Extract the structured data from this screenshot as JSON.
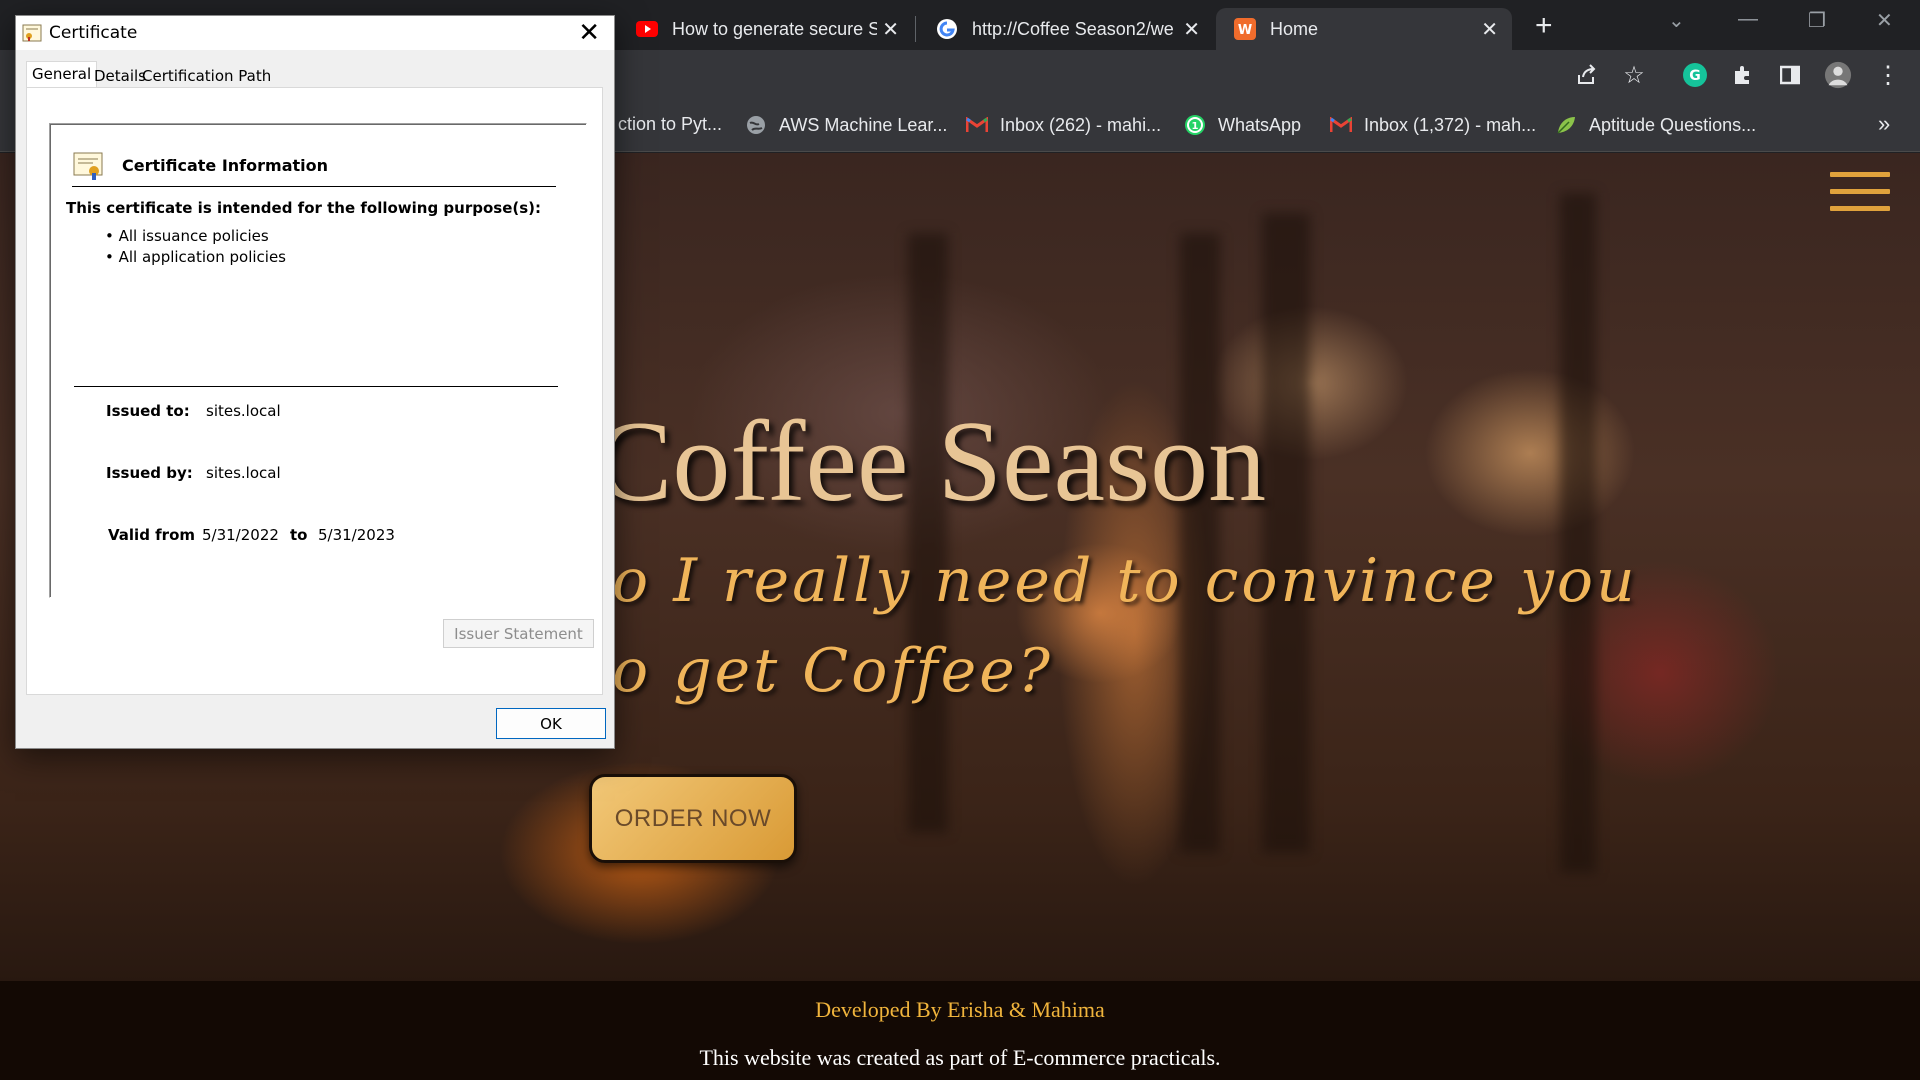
{
  "browser": {
    "tabs": [
      {
        "title": "How to generate secure S",
        "favicon": "youtube-icon"
      },
      {
        "title": "http://Coffee Season2/we",
        "favicon": "google-icon"
      },
      {
        "title": "Home",
        "favicon": "site-icon"
      }
    ],
    "bookmarks": [
      {
        "label": "ction to Pyt...",
        "icon": "page-icon"
      },
      {
        "label": "AWS Machine Lear...",
        "icon": "globe-icon"
      },
      {
        "label": "Inbox (262) - mahi...",
        "icon": "gmail-icon"
      },
      {
        "label": "WhatsApp",
        "icon": "whatsapp-icon"
      },
      {
        "label": "Inbox (1,372) - mah...",
        "icon": "gmail-icon"
      },
      {
        "label": "Aptitude Questions...",
        "icon": "leaf-icon"
      }
    ],
    "more_bookmarks": "»"
  },
  "hero": {
    "title": "Coffee Season",
    "subtitle_line1": "o I really need to convince you",
    "subtitle_line2": "o get Coffee?",
    "order_button": "ORDER NOW"
  },
  "footer": {
    "developed_by": "Developed By Erisha & Mahima",
    "note": "This website was created as part of E-commerce practicals."
  },
  "dialog": {
    "title": "Certificate",
    "tabs": [
      "General",
      "Details",
      "Certification Path"
    ],
    "info_heading": "Certificate Information",
    "purpose_heading": "This certificate is intended for the following purpose(s):",
    "purposes": [
      "• All issuance policies",
      "• All application policies"
    ],
    "issued_to_label": "Issued to:",
    "issued_to": "sites.local",
    "issued_by_label": "Issued by:",
    "issued_by": "sites.local",
    "valid_from_label": "Valid from",
    "valid_from": "5/31/2022",
    "to_label": "to",
    "valid_to": "5/31/2023",
    "issuer_statement_button": "Issuer Statement",
    "ok_button": "OK"
  },
  "colors": {
    "accent_gold": "#f0b55a",
    "footer_bg": "#130904",
    "ok_border": "#0067c0"
  }
}
